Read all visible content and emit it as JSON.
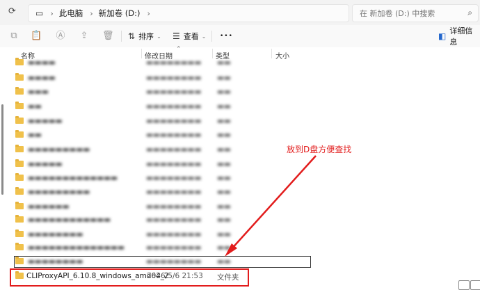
{
  "breadcrumb": {
    "items": [
      "此电脑",
      "新加卷 (D:)"
    ]
  },
  "search": {
    "placeholder": "在 新加卷 (D:) 中搜索"
  },
  "toolbar": {
    "sort_label": "排序",
    "view_label": "查看",
    "more_label": "•••",
    "details_label": "详细信息"
  },
  "columns": {
    "name": "名称",
    "date": "修改日期",
    "type": "类型",
    "size": "大小"
  },
  "highlight_row": {
    "name": "CLIProxyAPI_6.10.8_windows_amd64_2",
    "date": "2026/5/6 21:53",
    "type": "文件夹"
  },
  "annotation": {
    "text": "放到D盘方便查找"
  },
  "colors": {
    "annotation": "#e21c1c",
    "folder": "#f0c14b"
  }
}
